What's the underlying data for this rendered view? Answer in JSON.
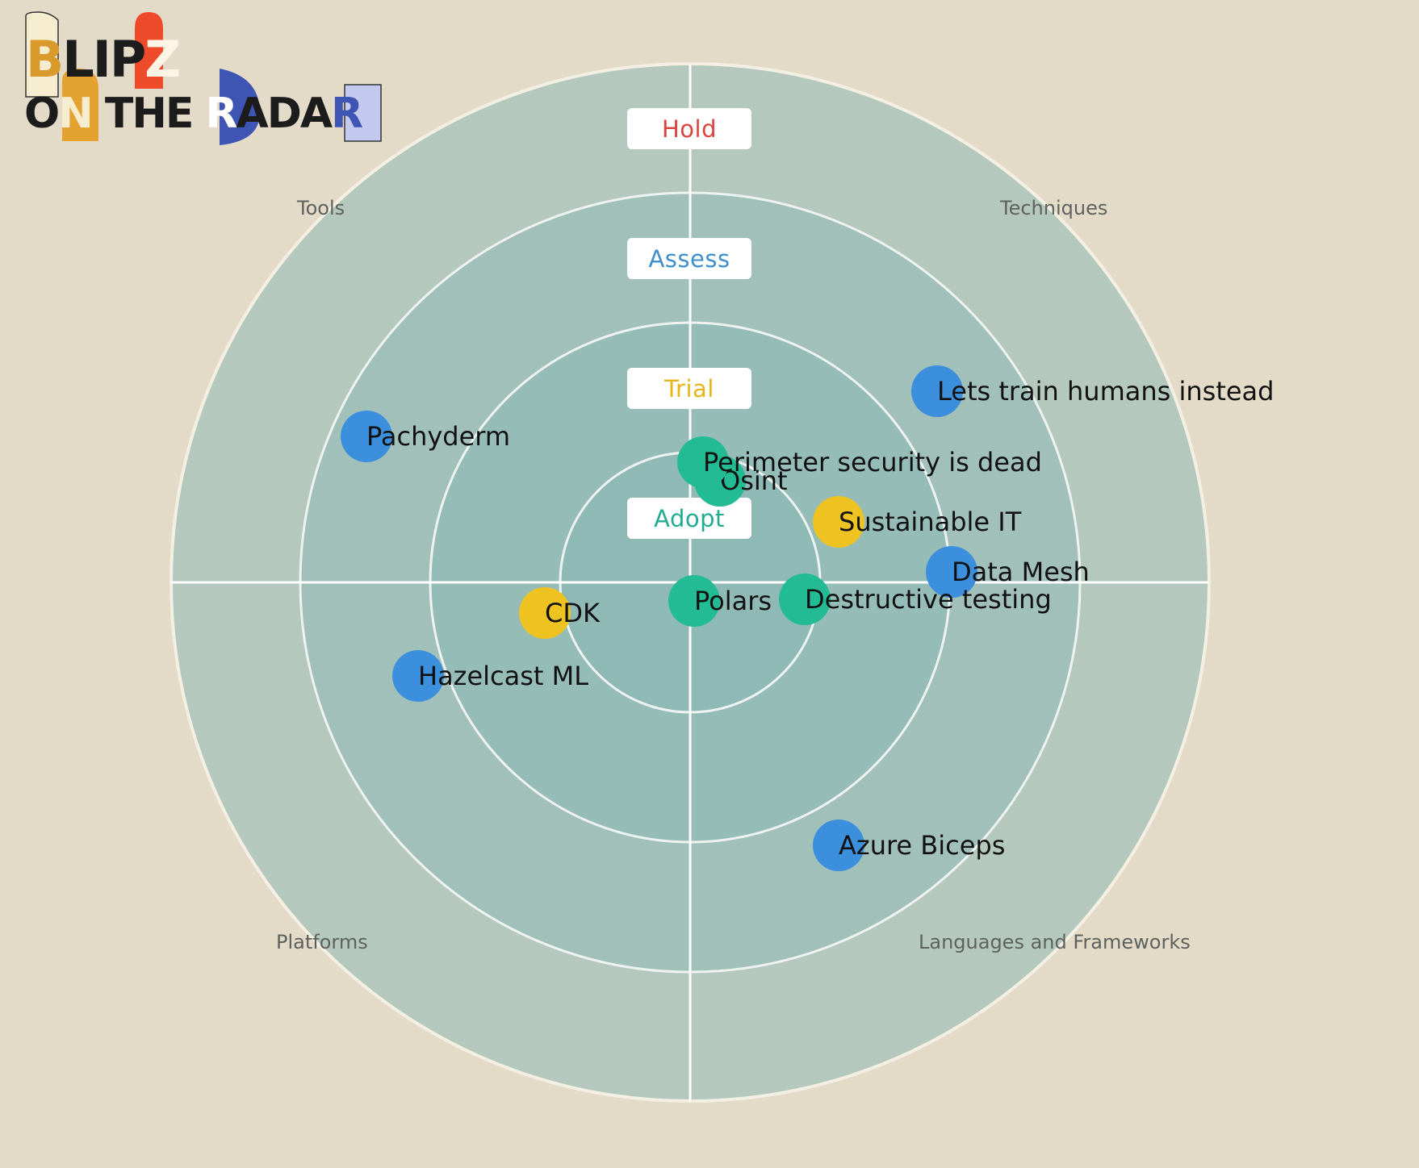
{
  "logo": {
    "line1": "BLIPZ",
    "line2": "ON THE RADAR"
  },
  "colors": {
    "background": "#e3dac8",
    "ring_outer": "#b4c8be",
    "ring_3": "#a1c0ba",
    "ring_2": "#95bcb7",
    "ring_1": "#8fb9b5",
    "hold": "#d9453d",
    "assess": "#3f8fce",
    "trial": "#e8b51c",
    "adopt": "#22ad92",
    "blip_blue": "#3b8fdc",
    "blip_yellow": "#edc221",
    "blip_green": "#22bb94"
  },
  "rings": [
    {
      "id": "hold",
      "label": "Hold",
      "color": "#d9453d"
    },
    {
      "id": "assess",
      "label": "Assess",
      "color": "#3f8fce"
    },
    {
      "id": "trial",
      "label": "Trial",
      "color": "#e8b51c"
    },
    {
      "id": "adopt",
      "label": "Adopt",
      "color": "#22ad92"
    }
  ],
  "quadrants": {
    "top_left": "Tools",
    "top_right": "Techniques",
    "bottom_left": "Platforms",
    "bottom_right": "Languages and Frameworks"
  },
  "blips": [
    {
      "name": "Lets train humans instead",
      "color": "blue",
      "quadrant": "Techniques",
      "ring": "Assess"
    },
    {
      "name": "Pachyderm",
      "color": "blue",
      "quadrant": "Tools",
      "ring": "Assess"
    },
    {
      "name": "Perimeter security is dead",
      "color": "green",
      "quadrant": "Techniques",
      "ring": "Adopt"
    },
    {
      "name": "Osint",
      "color": "green",
      "quadrant": "Techniques",
      "ring": "Adopt"
    },
    {
      "name": "Sustainable IT",
      "color": "yellow",
      "quadrant": "Techniques",
      "ring": "Trial"
    },
    {
      "name": "Data Mesh",
      "color": "blue",
      "quadrant": "Techniques",
      "ring": "Assess"
    },
    {
      "name": "CDK",
      "color": "yellow",
      "quadrant": "Platforms",
      "ring": "Trial"
    },
    {
      "name": "Polars",
      "color": "green",
      "quadrant": "Languages and Frameworks",
      "ring": "Adopt"
    },
    {
      "name": "Destructive testing",
      "color": "green",
      "quadrant": "Languages and Frameworks",
      "ring": "Adopt"
    },
    {
      "name": "Hazelcast ML",
      "color": "blue",
      "quadrant": "Platforms",
      "ring": "Assess"
    },
    {
      "name": "Azure Biceps",
      "color": "blue",
      "quadrant": "Languages and Frameworks",
      "ring": "Assess"
    }
  ]
}
